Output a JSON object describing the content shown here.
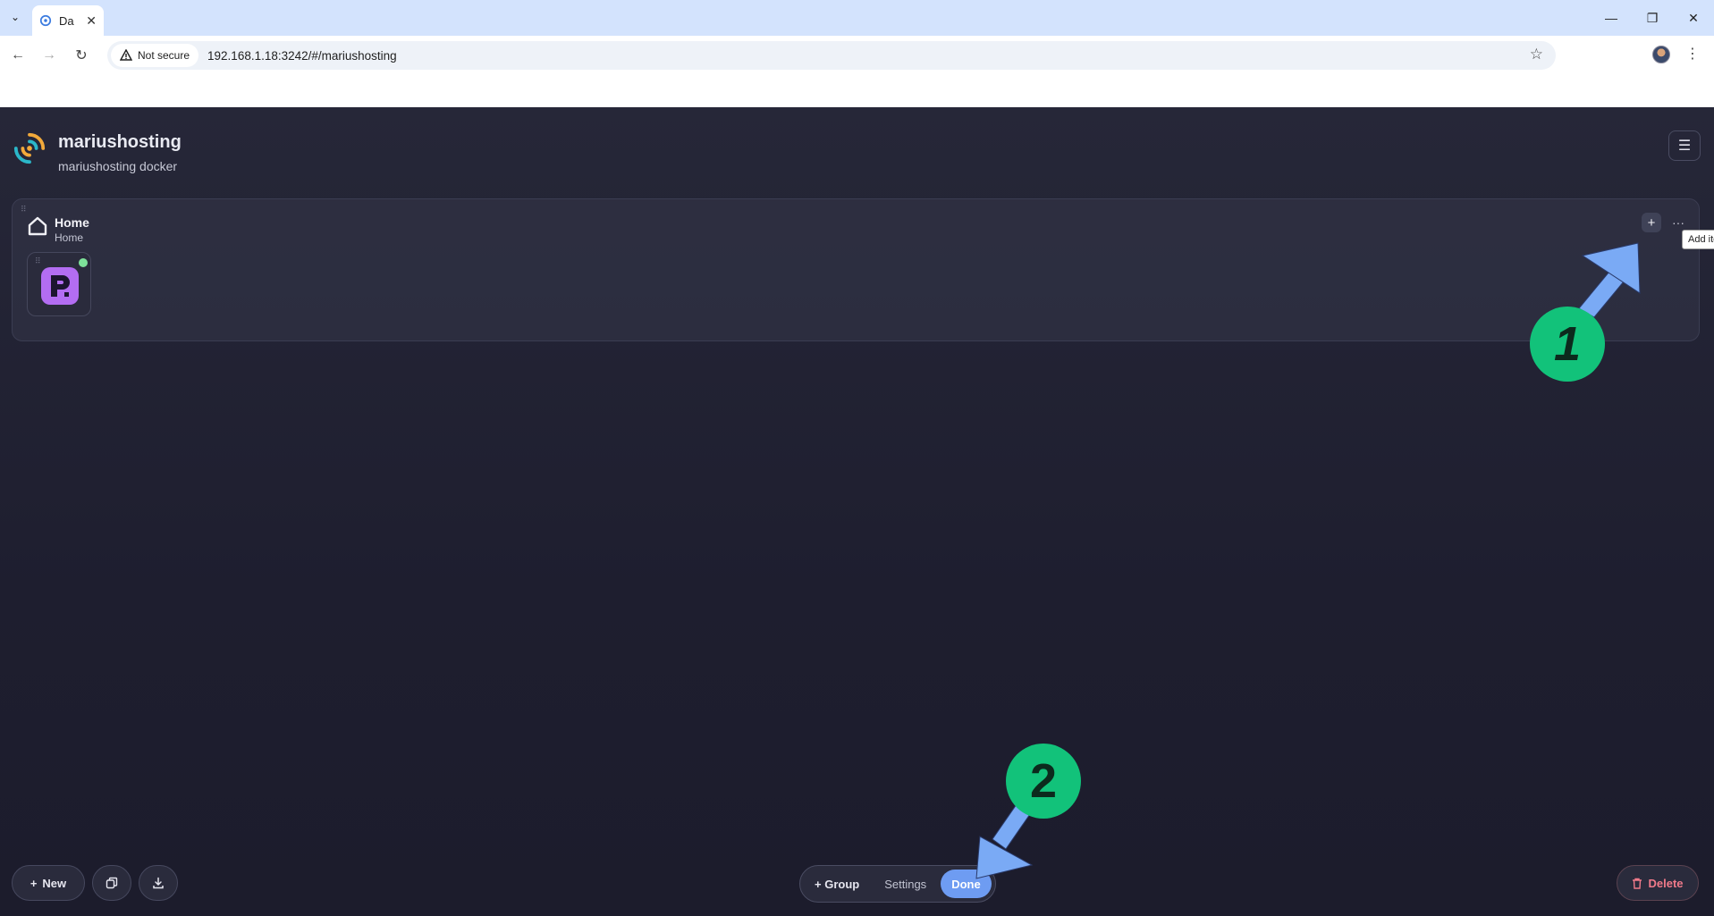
{
  "browser": {
    "tab_title": "Da",
    "security_label": "Not secure",
    "url": "192.168.1.18:3242/#/mariushosting"
  },
  "header": {
    "title": "mariushosting",
    "subtitle": "mariushosting docker"
  },
  "group": {
    "title": "Home",
    "description": "Home",
    "add_tooltip": "Add item",
    "items": [
      {
        "name": "P",
        "status": "online"
      }
    ]
  },
  "bottom_left": {
    "new_label": "New"
  },
  "edit_bar": {
    "group_label": "+ Group",
    "settings_label": "Settings",
    "done_label": "Done"
  },
  "delete_label": "Delete",
  "annotations": {
    "badge_1": "1",
    "badge_2": "2"
  },
  "colors": {
    "accent": "#6e9cf2",
    "status_online": "#7ee29a",
    "badge": "#12c27a",
    "arrow": "#7aaaf5",
    "delete": "#f07a8a",
    "item_icon": "#b36df2"
  }
}
